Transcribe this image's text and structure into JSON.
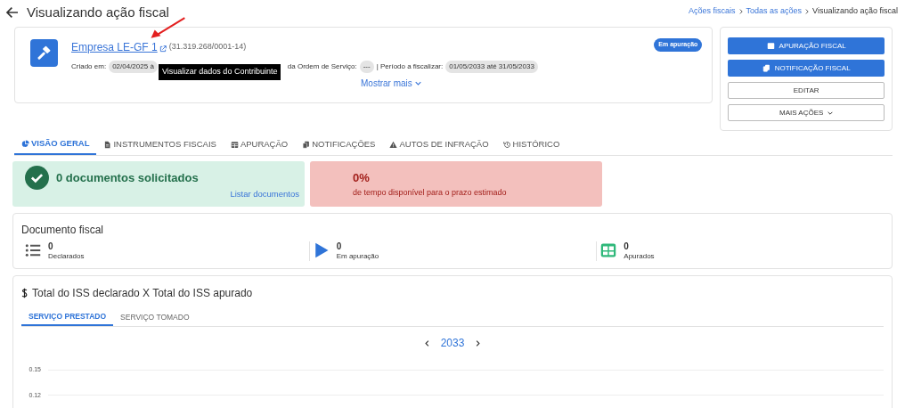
{
  "page_title": "Visualizando ação fiscal",
  "breadcrumb": [
    {
      "label": "Ações fiscais",
      "kind": "link"
    },
    {
      "label": "Todas as ações",
      "kind": "link"
    },
    {
      "label": "Visualizando ação fiscal",
      "kind": "current"
    }
  ],
  "company": {
    "name": "Empresa LE-GF 1",
    "document": "(31.319.268/0001-14)",
    "status_badge": "Em apuração",
    "tooltip": "Visualizar dados do Contribuinte",
    "meta": [
      {
        "label": "Criado em:",
        "value": "02/04/2025 à"
      },
      {
        "label": "da Ordem de Serviço:",
        "value": "---"
      },
      {
        "label": "| Período a fiscalizar:",
        "value": "01/05/2033 até 31/05/2033"
      }
    ],
    "show_more": "Mostrar mais"
  },
  "actions": [
    {
      "label": "APURAÇÃO FISCAL",
      "kind": "primary"
    },
    {
      "label": "NOTIFICAÇÃO FISCAL",
      "kind": "primary"
    },
    {
      "label": "EDITAR",
      "kind": "outline"
    },
    {
      "label": "MAIS AÇÕES",
      "kind": "dropdown"
    }
  ],
  "tabs": [
    {
      "label": "VISÃO GERAL",
      "selected": true
    },
    {
      "label": "INSTRUMENTOS FISCAIS",
      "selected": false
    },
    {
      "label": "APURAÇÃO",
      "selected": false
    },
    {
      "label": "NOTIFICAÇÕES",
      "selected": false
    },
    {
      "label": "AUTOS DE INFRAÇÃO",
      "selected": false
    },
    {
      "label": "HISTÓRICO",
      "selected": false
    }
  ],
  "documents_card": {
    "title": "0 documentos solicitados",
    "link": "Listar documentos"
  },
  "deadline_card": {
    "percent": "0%",
    "caption": "de tempo disponível para o prazo estimado"
  },
  "fiscal_document": {
    "title": "Documento fiscal",
    "stats": [
      {
        "value": "0",
        "label": "Declarados"
      },
      {
        "value": "0",
        "label": "Em apuração"
      },
      {
        "value": "0",
        "label": "Apurados"
      }
    ]
  },
  "iss_panel": {
    "title": "Total do ISS declarado X Total do ISS apurado",
    "tabs": [
      {
        "label": "SERVIÇO PRESTADO",
        "selected": true
      },
      {
        "label": "SERVIÇO TOMADO",
        "selected": false
      }
    ],
    "year": "2033",
    "y_tick_labels": [
      "0.15",
      "0.12"
    ]
  }
}
